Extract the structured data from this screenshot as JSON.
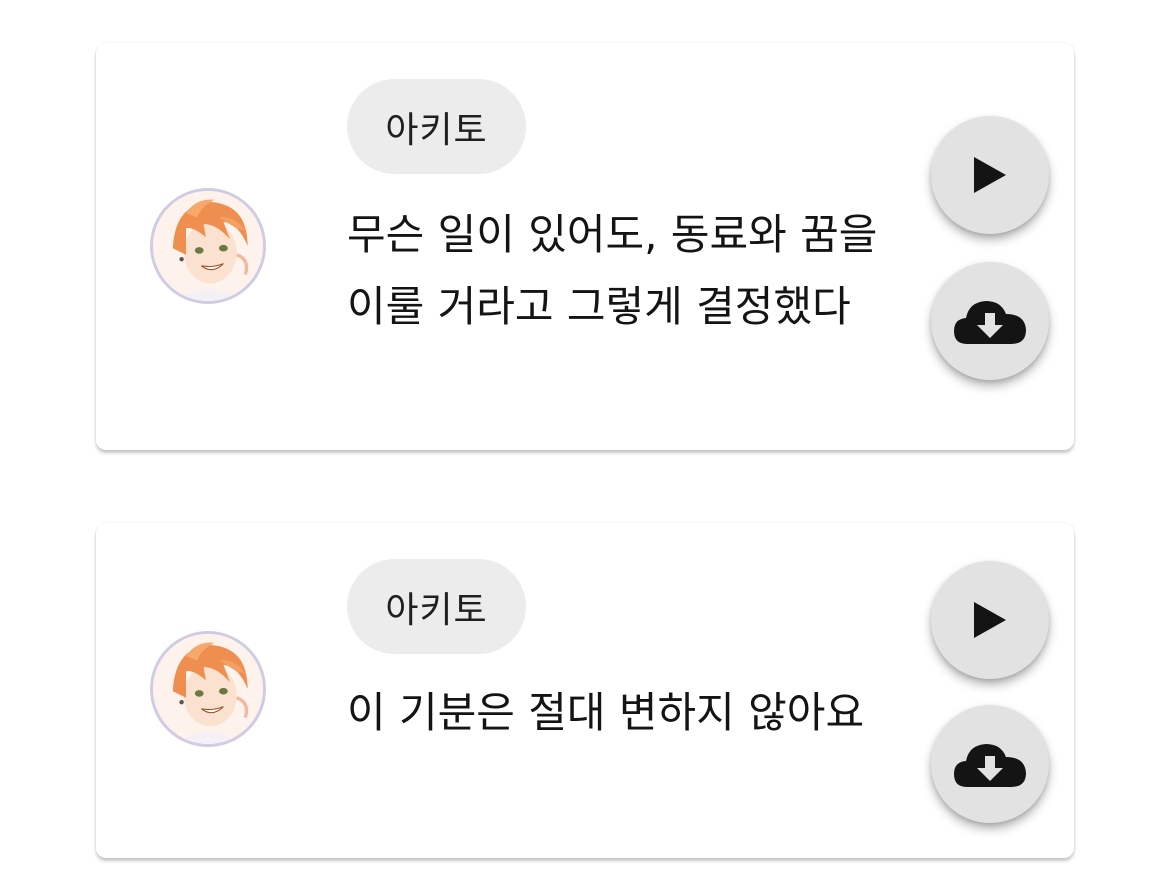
{
  "colors": {
    "card_background": "#ffffff",
    "chip_background": "#ececec",
    "button_background": "#e2e2e2",
    "avatar_border": "#cfcce3",
    "icon": "#141414"
  },
  "voice_lines": [
    {
      "speaker": "아키토",
      "text": "무슨 일이 있어도, 동료와 꿈을 이룰 거라고 그렇게 결정했다",
      "avatar_icon": "character-portrait",
      "play_icon": "play-icon",
      "download_icon": "cloud-download-icon"
    },
    {
      "speaker": "아키토",
      "text": "이 기분은 절대 변하지 않아요",
      "avatar_icon": "character-portrait",
      "play_icon": "play-icon",
      "download_icon": "cloud-download-icon"
    }
  ]
}
